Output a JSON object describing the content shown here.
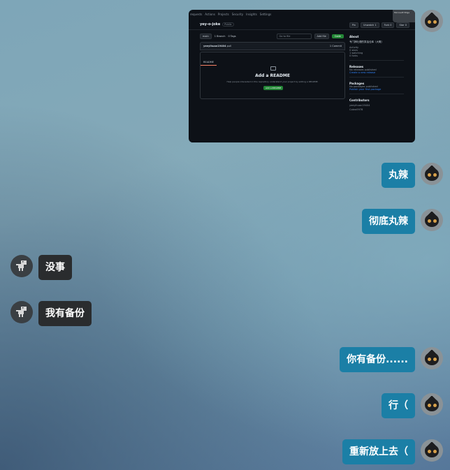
{
  "messages": [
    {
      "side": "right",
      "type": "image"
    },
    {
      "side": "right",
      "text": "丸辣"
    },
    {
      "side": "right",
      "text": "彻底丸辣"
    },
    {
      "side": "left",
      "text": "没事"
    },
    {
      "side": "left",
      "text": "我有备份"
    },
    {
      "side": "right",
      "text": "你有备份......"
    },
    {
      "side": "right",
      "text": "行（"
    },
    {
      "side": "right",
      "text": "重新放上去（"
    }
  ],
  "screenshot": {
    "nav": [
      "requests",
      "Actions",
      "Projects",
      "Security",
      "Insights",
      "Settings"
    ],
    "repo_name": "yey-o-joke",
    "visibility": "Public",
    "actions": [
      "Pin",
      "Unwatch 1",
      "Fork 0",
      "Star 0"
    ],
    "toolbar": {
      "branch": "main",
      "branches": "1 Branch",
      "tags": "0 Tags",
      "go_to_file": "Go to file",
      "add_file": "Add file",
      "code": "Code"
    },
    "commit": {
      "author": "yeeyihuan19404",
      "msg": "pull",
      "meta": "1 Commit"
    },
    "readme": {
      "tab": "README",
      "title": "Add a README",
      "hint": "Help people interested in this repository understand your project by adding a README.",
      "button": "Add a README"
    },
    "sidebar": {
      "about_title": "About",
      "about_desc": "专门搞吐槽的笑话仓库（大概）",
      "stats": [
        "Activity",
        "0 stars",
        "1 watching",
        "0 forks"
      ],
      "releases_title": "Releases",
      "releases_text": "No releases published",
      "releases_link": "Create a new release",
      "packages_title": "Packages",
      "packages_text": "No packages published",
      "packages_link": "Publish your first package",
      "contributors_title": "Contributors",
      "contributors": [
        "yeeyihuan19404",
        "Cobra5978"
      ]
    },
    "corner_label": "Microsoft Edge"
  }
}
